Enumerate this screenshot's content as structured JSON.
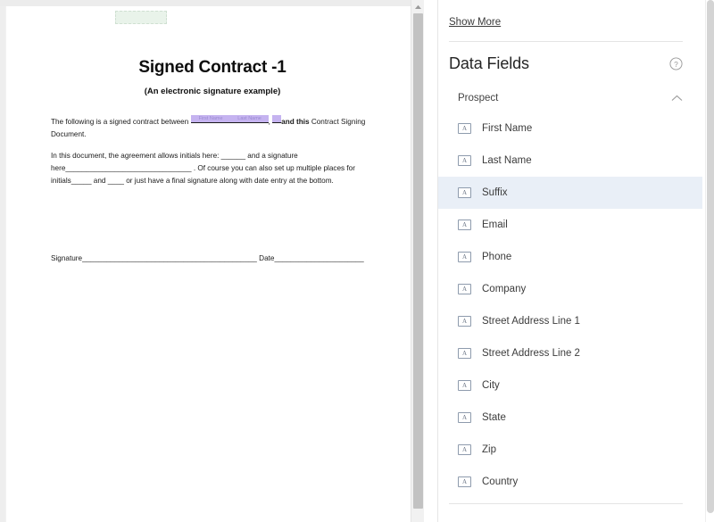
{
  "document": {
    "title": "Signed Contract -1",
    "subtitle": "(An electronic signature example)",
    "paragraph1": {
      "lead": "The following is a signed contract between",
      "tag_first_name": "First Name",
      "tag_last_name": "Last Name",
      "comma": ",",
      "bold_run": "and this",
      "tail": "Contract Signing Document."
    },
    "paragraph2": {
      "line1": "In this document, the agreement allows initials here: ______ and a signature",
      "line2": "here_______________________________ . Of course you can also set up multiple places for",
      "line3": "initials_____ and ____ or just have a final signature along with date entry at the bottom."
    },
    "signature_line": {
      "signature_label": "Signature",
      "signature_rule": "___________________________________________",
      "date_label": "Date",
      "date_rule": "______________________"
    },
    "drop_placeholder_color": "#e9f3ea",
    "field_tag_color": "#c5b3f0"
  },
  "panel": {
    "show_more_label": "Show More",
    "title": "Data Fields",
    "help_icon": "question-circle-icon",
    "group": {
      "label": "Prospect",
      "chevron": "chevron-up-icon",
      "expanded": true
    },
    "field_icon_glyph": "A",
    "selected_field": "Suffix",
    "selected_row_color": "#e9eff7",
    "fields": [
      {
        "label": "First Name",
        "icon": "text-field-icon",
        "selected": false
      },
      {
        "label": "Last Name",
        "icon": "text-field-icon",
        "selected": false
      },
      {
        "label": "Suffix",
        "icon": "text-field-icon",
        "selected": true
      },
      {
        "label": "Email",
        "icon": "text-field-icon",
        "selected": false
      },
      {
        "label": "Phone",
        "icon": "text-field-icon",
        "selected": false
      },
      {
        "label": "Company",
        "icon": "text-field-icon",
        "selected": false
      },
      {
        "label": "Street Address Line 1",
        "icon": "text-field-icon",
        "selected": false
      },
      {
        "label": "Street Address Line 2",
        "icon": "text-field-icon",
        "selected": false
      },
      {
        "label": "City",
        "icon": "text-field-icon",
        "selected": false
      },
      {
        "label": "State",
        "icon": "text-field-icon",
        "selected": false
      },
      {
        "label": "Zip",
        "icon": "text-field-icon",
        "selected": false
      },
      {
        "label": "Country",
        "icon": "text-field-icon",
        "selected": false
      }
    ]
  }
}
